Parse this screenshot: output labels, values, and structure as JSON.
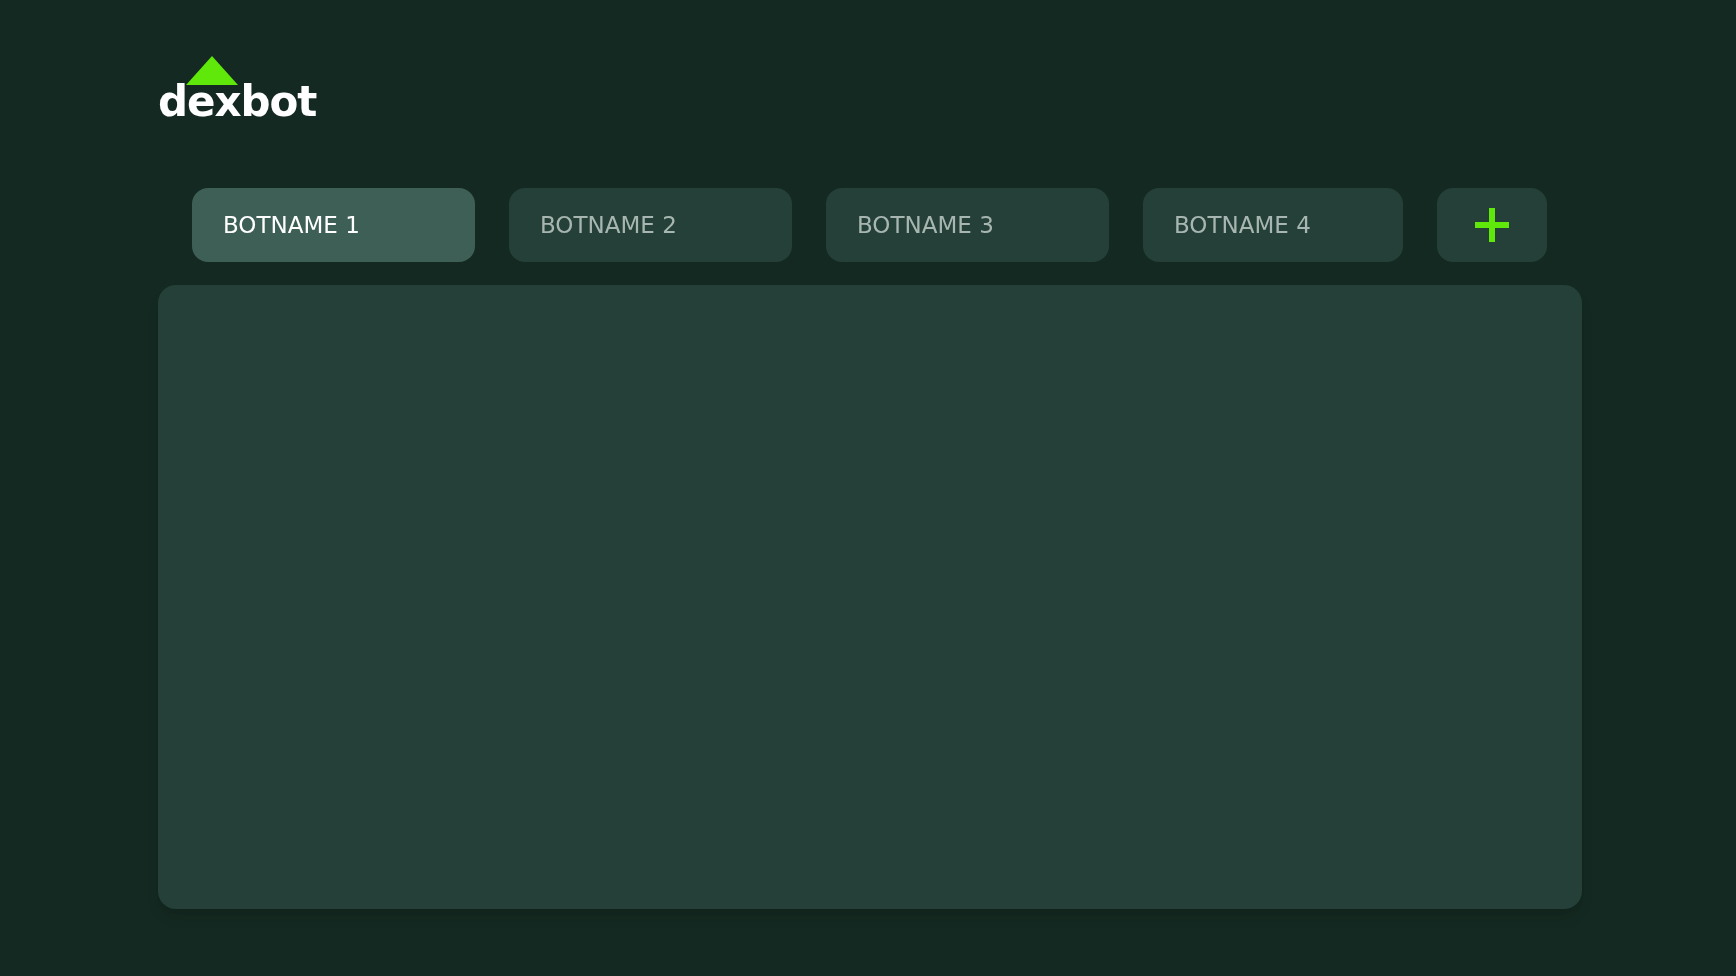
{
  "logo": {
    "text": "dexbot"
  },
  "tabs": [
    {
      "label": "BOTNAME 1",
      "selected": true
    },
    {
      "label": "BOTNAME 2",
      "selected": false
    },
    {
      "label": "BOTNAME 3",
      "selected": false
    },
    {
      "label": "BOTNAME 4",
      "selected": false
    }
  ]
}
